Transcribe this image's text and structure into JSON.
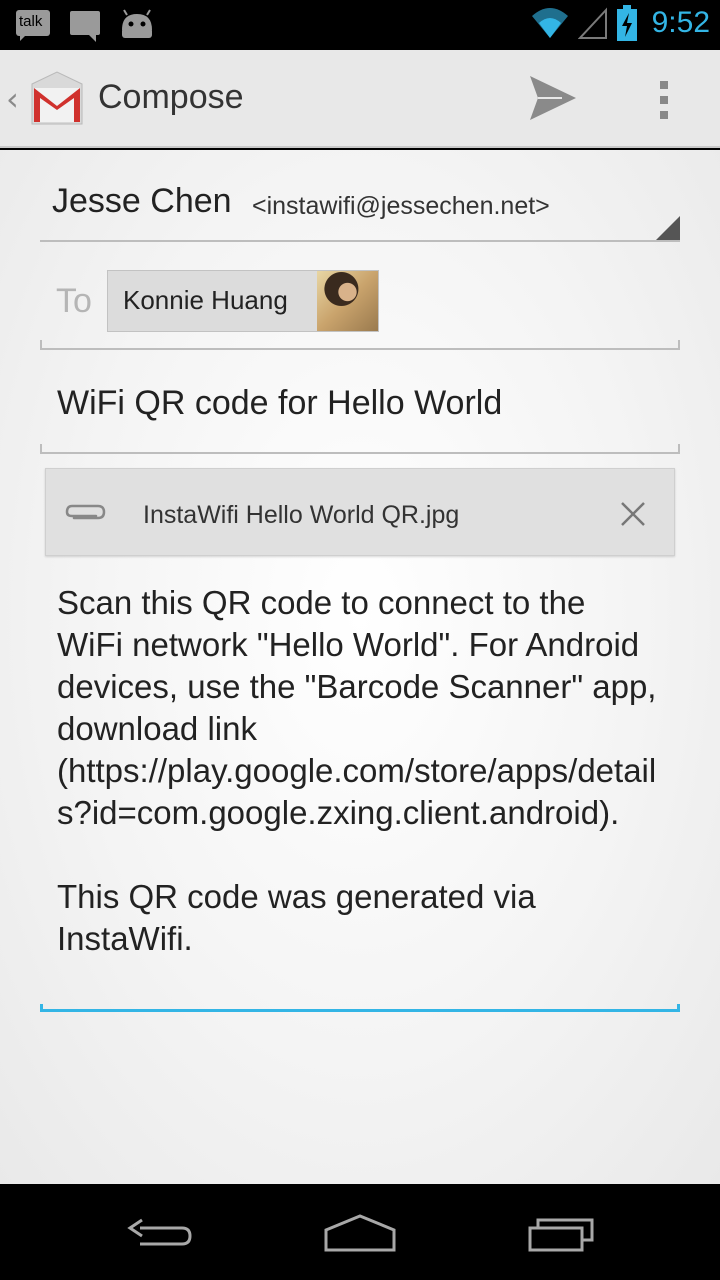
{
  "status_bar": {
    "notifications": [
      "talk-icon",
      "message-icon",
      "android-icon"
    ],
    "talk_label": "talk",
    "time": "9:52",
    "accent_color": "#33b5e5"
  },
  "action_bar": {
    "title": "Compose",
    "actions": [
      "send-icon",
      "overflow-menu-icon"
    ]
  },
  "compose": {
    "from": {
      "name": "Jesse Chen",
      "email": "<instawifi@jessechen.net>"
    },
    "to": {
      "label": "To",
      "recipients": [
        {
          "name": "Konnie Huang",
          "avatar": "contact-photo"
        }
      ]
    },
    "subject": "WiFi QR code for Hello World",
    "attachment": {
      "filename": "InstaWifi Hello World QR.jpg"
    },
    "body": "Scan this QR code to connect to the WiFi network \"Hello World\". For Android devices, use the \"Barcode Scanner\" app, download link (https://play.google.com/store/apps/details?id=com.google.zxing.client.android).\n\nThis QR code was generated via InstaWifi."
  },
  "nav_bar": {
    "buttons": [
      "back-icon",
      "home-icon",
      "recent-apps-icon"
    ]
  }
}
